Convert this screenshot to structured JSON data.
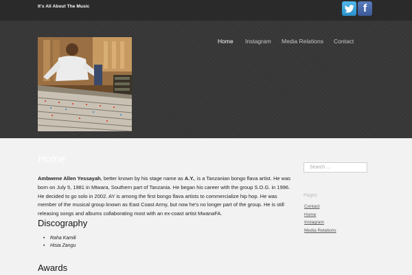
{
  "site": {
    "tagline": "It's All About The Music"
  },
  "social": [
    {
      "name": "twitter-icon",
      "color": "#3aa2dc"
    },
    {
      "name": "facebook-icon",
      "label": "f",
      "color": "#3b5998"
    }
  ],
  "nav": {
    "items": [
      {
        "label": "Home",
        "active": true
      },
      {
        "label": "Instagram"
      },
      {
        "label": "Media Relations"
      },
      {
        "label": "Contact"
      }
    ]
  },
  "page": {
    "title": "Home",
    "bio_name": "Ambwene Allen Yessayah",
    "bio_text_1": ", better known by his stage name as ",
    "bio_stage_name": "A.Y.",
    "bio_text_2": ", is a Tanzanian bongo flava artist. He was born on July 5, 1981 in Mtwara, Southern part of Tanzania. He began his career with the group S.O.G. in 1996. He decided to go solo in 2002. AY is among the first bongo flava artists to commercialize hip hop. He was member of the musical group known as East Coast Army, but now he's no longer part of the group. He is still releasing songs and albums collaborating most with an ex-coast artist MwanaFA.",
    "discography_heading": "Discography",
    "discography": [
      "Raha Kamili",
      "Hisia Zangu"
    ],
    "awards_heading": "Awards"
  },
  "sidebar": {
    "search_placeholder": "Search ...",
    "pages_title": "Pages",
    "pages": [
      "Contact",
      "Home",
      "Instagram",
      "Media Relations"
    ]
  }
}
